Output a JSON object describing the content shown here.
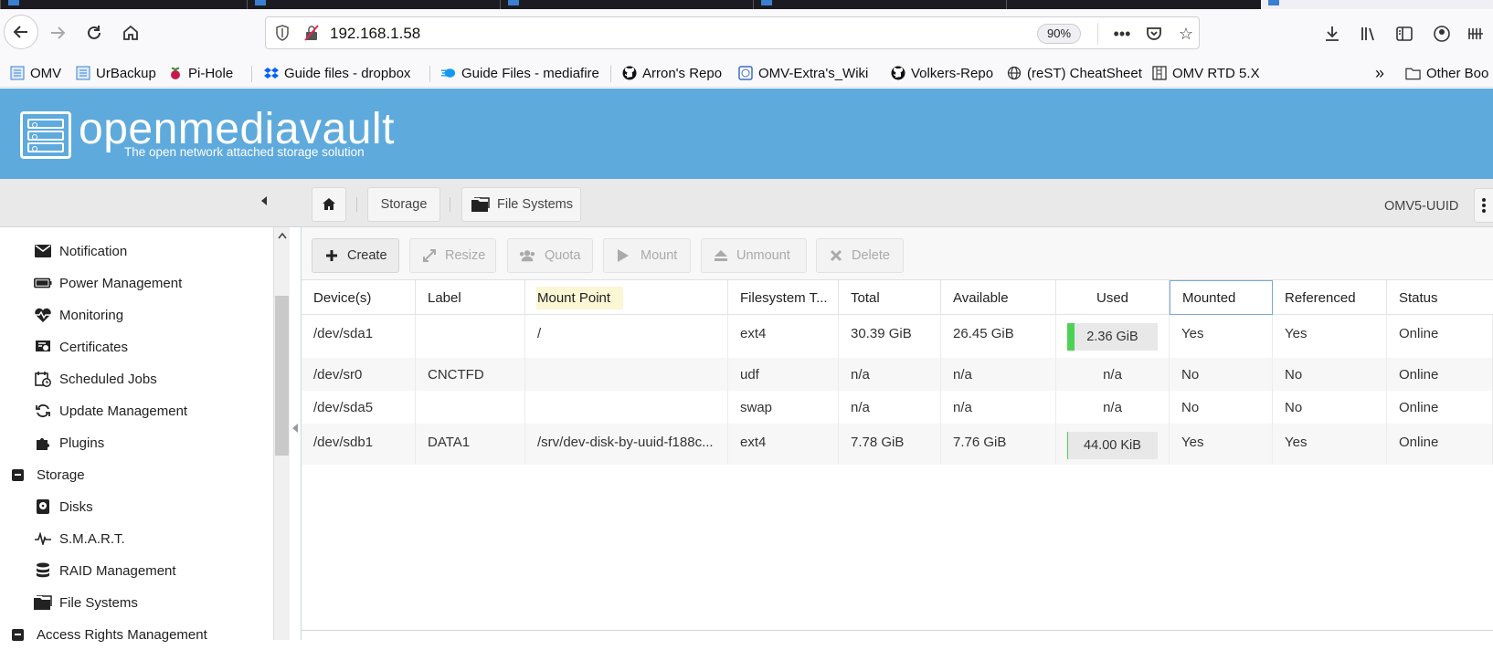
{
  "browser": {
    "url": "192.168.1.58",
    "zoom": "90%",
    "bookmarks": [
      {
        "label": "OMV",
        "icon": "page-icon"
      },
      {
        "label": "UrBackup",
        "icon": "page-icon"
      },
      {
        "label": "Pi-Hole",
        "icon": "raspberry-icon"
      },
      {
        "label": "Guide files - dropbox",
        "icon": "dropbox-icon"
      },
      {
        "label": "Guide Files - mediafire",
        "icon": "mediafire-icon"
      },
      {
        "label": "Arron's Repo",
        "icon": "github-icon"
      },
      {
        "label": "OMV-Extra's_Wiki",
        "icon": "wiki-icon"
      },
      {
        "label": "Volkers-Repo",
        "icon": "github-icon"
      },
      {
        "label": "(reST) CheatSheet",
        "icon": "globe-icon"
      },
      {
        "label": "OMV RTD 5.X",
        "icon": "doc-icon"
      }
    ],
    "other_bookmarks": "Other Boo"
  },
  "header": {
    "brand": "openmediavault",
    "tagline": "The open network attached storage solution"
  },
  "breadcrumb": {
    "section": "Storage",
    "page": "File Systems",
    "host": "OMV5-UUID"
  },
  "sidebar": {
    "items": [
      {
        "label": "Notification",
        "icon": "envelope-icon",
        "level": 2
      },
      {
        "label": "Power Management",
        "icon": "battery-icon",
        "level": 2
      },
      {
        "label": "Monitoring",
        "icon": "heartbeat-icon",
        "level": 2
      },
      {
        "label": "Certificates",
        "icon": "certificate-icon",
        "level": 2
      },
      {
        "label": "Scheduled Jobs",
        "icon": "calendar-clock-icon",
        "level": 2
      },
      {
        "label": "Update Management",
        "icon": "refresh-icon",
        "level": 2
      },
      {
        "label": "Plugins",
        "icon": "puzzle-icon",
        "level": 2
      },
      {
        "label": "Storage",
        "icon": "collapse-icon",
        "level": 1
      },
      {
        "label": "Disks",
        "icon": "disk-icon",
        "level": 2
      },
      {
        "label": "S.M.A.R.T.",
        "icon": "pulse-icon",
        "level": 2
      },
      {
        "label": "RAID Management",
        "icon": "database-icon",
        "level": 2
      },
      {
        "label": "File Systems",
        "icon": "folders-icon",
        "level": 2
      },
      {
        "label": "Access Rights Management",
        "icon": "collapse-icon",
        "level": 1
      }
    ]
  },
  "actions": [
    {
      "label": "Create",
      "icon": "plus-icon",
      "enabled": true
    },
    {
      "label": "Resize",
      "icon": "expand-icon",
      "enabled": false
    },
    {
      "label": "Quota",
      "icon": "users-icon",
      "enabled": false
    },
    {
      "label": "Mount",
      "icon": "play-icon",
      "enabled": false
    },
    {
      "label": "Unmount",
      "icon": "eject-icon",
      "enabled": false
    },
    {
      "label": "Delete",
      "icon": "times-icon",
      "enabled": false
    }
  ],
  "table": {
    "columns": [
      "Device(s)",
      "Label",
      "Mount Point",
      "Filesystem T...",
      "Total",
      "Available",
      "Used",
      "Mounted",
      "Referenced",
      "Status"
    ],
    "rows": [
      {
        "device": "/dev/sda1",
        "label": "",
        "mount_point": "/",
        "fs": "ext4",
        "total": "30.39 GiB",
        "available": "26.45 GiB",
        "used": "2.36 GiB",
        "used_fraction": 0.078,
        "mounted": "Yes",
        "referenced": "Yes",
        "status": "Online"
      },
      {
        "device": "/dev/sr0",
        "label": "CNCTFD",
        "mount_point": "",
        "fs": "udf",
        "total": "n/a",
        "available": "n/a",
        "used": "n/a",
        "used_fraction": null,
        "mounted": "No",
        "referenced": "No",
        "status": "Online"
      },
      {
        "device": "/dev/sda5",
        "label": "",
        "mount_point": "",
        "fs": "swap",
        "total": "n/a",
        "available": "n/a",
        "used": "n/a",
        "used_fraction": null,
        "mounted": "No",
        "referenced": "No",
        "status": "Online"
      },
      {
        "device": "/dev/sdb1",
        "label": "DATA1",
        "mount_point": "/srv/dev-disk-by-uuid-f188c...",
        "fs": "ext4",
        "total": "7.78 GiB",
        "available": "7.76 GiB",
        "used": "44.00 KiB",
        "used_fraction": 0.005,
        "mounted": "Yes",
        "referenced": "Yes",
        "status": "Online"
      }
    ]
  },
  "colors": {
    "header_bg": "#5eaadc",
    "used_bar": "#4cd154"
  }
}
